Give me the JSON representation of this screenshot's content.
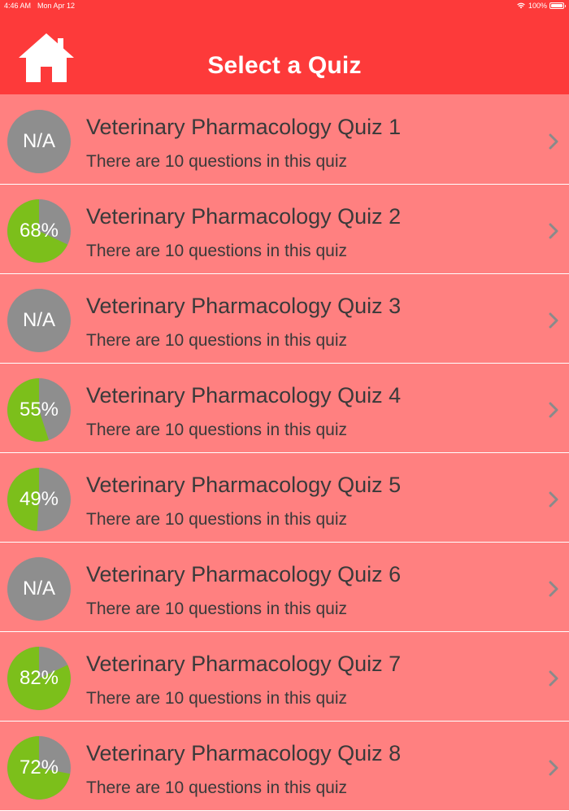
{
  "status_bar": {
    "time": "4:46 AM",
    "date": "Mon Apr 12",
    "battery": "100%"
  },
  "nav": {
    "title": "Select a Quiz",
    "home_icon": "home-icon"
  },
  "colors": {
    "header": "#fd3a3a",
    "background": "#ff8080",
    "pass": "#7cbf1b",
    "neutral": "#8e8e8e",
    "text": "#3a3a3a"
  },
  "quizzes": [
    {
      "title": "Veterinary Pharmacology Quiz 1",
      "subtitle": "There are 10 questions in this quiz",
      "score": "N/A",
      "percent": null
    },
    {
      "title": "Veterinary Pharmacology Quiz 2",
      "subtitle": "There are 10 questions in this quiz",
      "score": "68%",
      "percent": 68
    },
    {
      "title": "Veterinary Pharmacology Quiz 3",
      "subtitle": "There are 10 questions in this quiz",
      "score": "N/A",
      "percent": null
    },
    {
      "title": "Veterinary Pharmacology Quiz 4",
      "subtitle": "There are 10 questions in this quiz",
      "score": "55%",
      "percent": 55
    },
    {
      "title": "Veterinary Pharmacology Quiz 5",
      "subtitle": "There are 10 questions in this quiz",
      "score": "49%",
      "percent": 49
    },
    {
      "title": "Veterinary Pharmacology Quiz 6",
      "subtitle": "There are 10 questions in this quiz",
      "score": "N/A",
      "percent": null
    },
    {
      "title": "Veterinary Pharmacology Quiz 7",
      "subtitle": "There are 10 questions in this quiz",
      "score": "82%",
      "percent": 82
    },
    {
      "title": "Veterinary Pharmacology Quiz 8",
      "subtitle": "There are 10 questions in this quiz",
      "score": "72%",
      "percent": 72
    }
  ]
}
